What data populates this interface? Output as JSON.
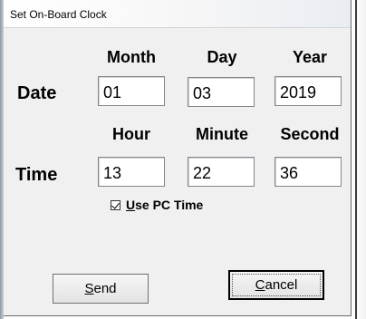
{
  "window": {
    "title": "Set On-Board Clock"
  },
  "date": {
    "label": "Date",
    "headers": {
      "month": "Month",
      "day": "Day",
      "year": "Year"
    },
    "values": {
      "month": "01",
      "day": "03",
      "year": "2019"
    }
  },
  "time": {
    "label": "Time",
    "headers": {
      "hour": "Hour",
      "minute": "Minute",
      "second": "Second"
    },
    "values": {
      "hour": "13",
      "minute": "22",
      "second": "36"
    }
  },
  "use_pc_time": {
    "checked": true,
    "mnemonic": "U",
    "label_rest": "se PC Time"
  },
  "buttons": {
    "send": {
      "mnemonic": "S",
      "rest": "end"
    },
    "cancel": {
      "mnemonic": "C",
      "rest": "ancel"
    }
  }
}
